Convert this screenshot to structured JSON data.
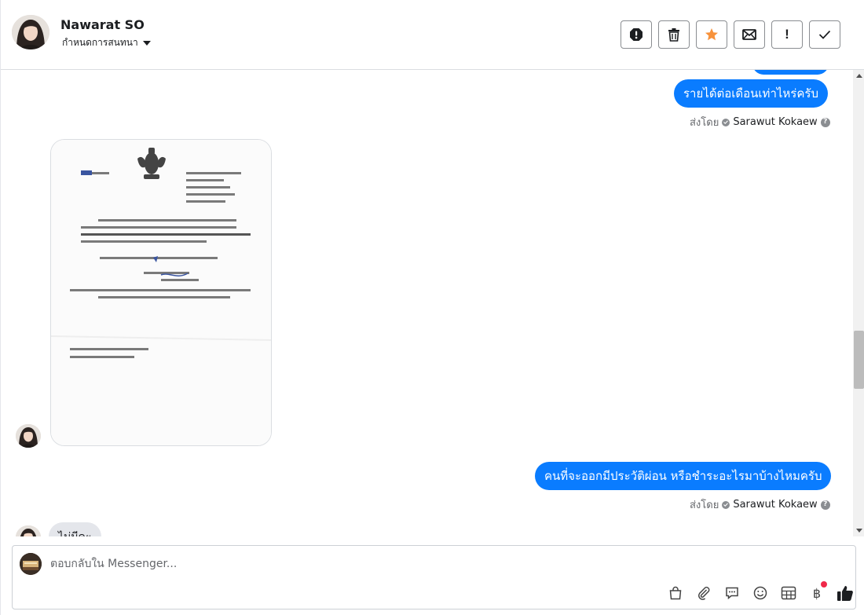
{
  "header": {
    "contact_name": "Nawarat SO",
    "assign_label": "กำหนดการสนทนา",
    "toolbar": [
      {
        "name": "report-spam-button",
        "icon": "alert-octagon-icon"
      },
      {
        "name": "delete-button",
        "icon": "trash-icon"
      },
      {
        "name": "star-button",
        "icon": "star-icon"
      },
      {
        "name": "mark-unread-button",
        "icon": "envelope-icon"
      },
      {
        "name": "follow-up-button",
        "icon": "exclamation-icon",
        "label": "!"
      },
      {
        "name": "mark-done-button",
        "icon": "check-icon"
      }
    ],
    "star_color": "#f7923b"
  },
  "messages": {
    "out_1": "รายได้ต่อเดือนเท่าไหร่ครับ",
    "out_1_sent_by_label": "ส่งโดย",
    "out_1_sender": "Sarawut Kokaew",
    "out_2": "คนที่จะออกมีประวัติผ่อน หรือชำระอะไรมาบ้างไหมครับ",
    "out_2_sent_by_label": "ส่งโดย",
    "out_2_sender": "Sarawut Kokaew",
    "in_partial": "ไม่มีคะ",
    "bubble_color": "#0a7cff"
  },
  "composer": {
    "placeholder": "ตอบกลับใน Messenger...",
    "tools": [
      "shopping-bag-icon",
      "paperclip-icon",
      "saved-reply-icon",
      "emoji-icon",
      "table-icon",
      "baht-icon",
      "thumbs-up-icon"
    ],
    "baht_symbol": "฿"
  }
}
